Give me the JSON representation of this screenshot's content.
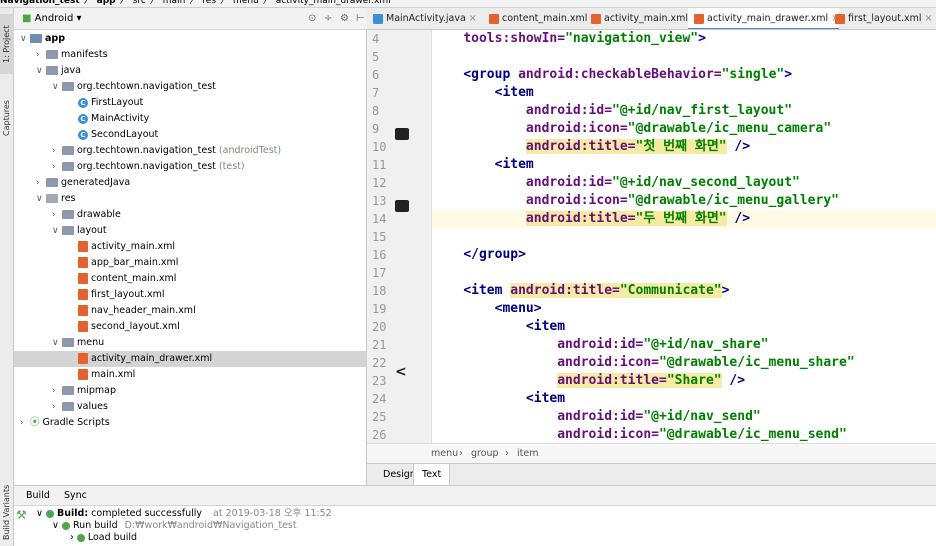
{
  "breadcrumb": [
    "Navigation_test",
    "app",
    "src",
    "main",
    "res",
    "menu",
    "activity_main_drawer.xml"
  ],
  "left_strip": {
    "project": "1: Project",
    "captures": "Captures",
    "build_variants": "Build Variants"
  },
  "project_panel": {
    "view_selector": "Android",
    "tree": [
      {
        "label": "app",
        "depth": 0,
        "kind": "app",
        "arrow": "v"
      },
      {
        "label": "manifests",
        "depth": 1,
        "kind": "folder",
        "arrow": ">"
      },
      {
        "label": "java",
        "depth": 1,
        "kind": "folder",
        "arrow": "v"
      },
      {
        "label": "org.techtown.navigation_test",
        "depth": 2,
        "kind": "folder",
        "arrow": "v"
      },
      {
        "label": "FirstLayout",
        "depth": 3,
        "kind": "class"
      },
      {
        "label": "MainActivity",
        "depth": 3,
        "kind": "class"
      },
      {
        "label": "SecondLayout",
        "depth": 3,
        "kind": "class"
      },
      {
        "label": "org.techtown.navigation_test",
        "suffix": "(androidTest)",
        "depth": 2,
        "kind": "folder",
        "arrow": ">"
      },
      {
        "label": "org.techtown.navigation_test",
        "suffix": "(test)",
        "depth": 2,
        "kind": "folder",
        "arrow": ">"
      },
      {
        "label": "generatedJava",
        "depth": 1,
        "kind": "folder",
        "arrow": ">"
      },
      {
        "label": "res",
        "depth": 1,
        "kind": "res",
        "arrow": "v"
      },
      {
        "label": "drawable",
        "depth": 2,
        "kind": "folder",
        "arrow": ">"
      },
      {
        "label": "layout",
        "depth": 2,
        "kind": "folder",
        "arrow": "v"
      },
      {
        "label": "activity_main.xml",
        "depth": 3,
        "kind": "xml"
      },
      {
        "label": "app_bar_main.xml",
        "depth": 3,
        "kind": "xml"
      },
      {
        "label": "content_main.xml",
        "depth": 3,
        "kind": "xml"
      },
      {
        "label": "first_layout.xml",
        "depth": 3,
        "kind": "xml"
      },
      {
        "label": "nav_header_main.xml",
        "depth": 3,
        "kind": "xml"
      },
      {
        "label": "second_layout.xml",
        "depth": 3,
        "kind": "xml"
      },
      {
        "label": "menu",
        "depth": 2,
        "kind": "folder",
        "arrow": "v"
      },
      {
        "label": "activity_main_drawer.xml",
        "depth": 3,
        "kind": "xml",
        "selected": true
      },
      {
        "label": "main.xml",
        "depth": 3,
        "kind": "xml"
      },
      {
        "label": "mipmap",
        "depth": 2,
        "kind": "folder",
        "arrow": ">"
      },
      {
        "label": "values",
        "depth": 2,
        "kind": "folder",
        "arrow": ">"
      },
      {
        "label": "Gradle Scripts",
        "depth": 0,
        "kind": "gradle",
        "arrow": ">"
      }
    ]
  },
  "editor_tabs": [
    {
      "label": "MainActivity.java",
      "color": "#3a8fd8"
    },
    {
      "label": "content_main.xml",
      "color": "#e3622d"
    },
    {
      "label": "activity_main.xml",
      "color": "#e3622d"
    },
    {
      "label": "activity_main_drawer.xml",
      "color": "#e3622d",
      "active": true
    },
    {
      "label": "first_layout.xml",
      "color": "#e3622d"
    }
  ],
  "code_lines": [
    {
      "n": "4",
      "indent": "    ",
      "parts": [
        [
          "at",
          "tools:showIn="
        ],
        [
          "av",
          "\"navigation_view\""
        ],
        [
          "tg",
          ">"
        ]
      ]
    },
    {
      "n": "5",
      "indent": "",
      "parts": []
    },
    {
      "n": "6",
      "indent": "    ",
      "parts": [
        [
          "tg",
          "<group "
        ],
        [
          "at",
          "android:checkableBehavior="
        ],
        [
          "av",
          "\"single\""
        ],
        [
          "tg",
          ">"
        ]
      ]
    },
    {
      "n": "7",
      "indent": "        ",
      "parts": [
        [
          "tg",
          "<item"
        ]
      ]
    },
    {
      "n": "8",
      "indent": "            ",
      "parts": [
        [
          "at",
          "android:id="
        ],
        [
          "av",
          "\"@+id/nav_first_layout\""
        ]
      ]
    },
    {
      "n": "9",
      "indent": "            ",
      "parts": [
        [
          "at",
          "android:icon="
        ],
        [
          "av",
          "\"@drawable/ic_menu_camera\""
        ]
      ]
    },
    {
      "n": "10",
      "indent": "            ",
      "parts": [
        [
          "hat",
          "android:title="
        ],
        [
          "hav",
          "\"첫 번째 화면\""
        ],
        [
          "tg",
          " />"
        ]
      ]
    },
    {
      "n": "11",
      "indent": "        ",
      "parts": [
        [
          "tg",
          "<item"
        ]
      ]
    },
    {
      "n": "12",
      "indent": "            ",
      "parts": [
        [
          "at",
          "android:id="
        ],
        [
          "av",
          "\"@+id/nav_second_layout\""
        ]
      ]
    },
    {
      "n": "13",
      "indent": "            ",
      "parts": [
        [
          "at",
          "android:icon="
        ],
        [
          "av",
          "\"@drawable/ic_menu_gallery\""
        ]
      ]
    },
    {
      "n": "14",
      "indent": "            ",
      "parts": [
        [
          "hat",
          "android:title="
        ],
        [
          "hav",
          "\"두 번째 화면\""
        ],
        [
          "tg",
          " />"
        ]
      ],
      "current": true
    },
    {
      "n": "15",
      "indent": "",
      "parts": []
    },
    {
      "n": "16",
      "indent": "    ",
      "parts": [
        [
          "tg",
          "</group>"
        ]
      ]
    },
    {
      "n": "17",
      "indent": "",
      "parts": []
    },
    {
      "n": "18",
      "indent": "    ",
      "parts": [
        [
          "tg",
          "<item "
        ],
        [
          "hat",
          "android:title="
        ],
        [
          "hav",
          "\"Communicate\""
        ],
        [
          "tg",
          ">"
        ]
      ]
    },
    {
      "n": "19",
      "indent": "        ",
      "parts": [
        [
          "tg",
          "<menu>"
        ]
      ]
    },
    {
      "n": "20",
      "indent": "            ",
      "parts": [
        [
          "tg",
          "<item"
        ]
      ]
    },
    {
      "n": "21",
      "indent": "                ",
      "parts": [
        [
          "at",
          "android:id="
        ],
        [
          "av",
          "\"@+id/nav_share\""
        ]
      ]
    },
    {
      "n": "22",
      "indent": "                ",
      "parts": [
        [
          "at",
          "android:icon="
        ],
        [
          "av",
          "\"@drawable/ic_menu_share\""
        ]
      ]
    },
    {
      "n": "23",
      "indent": "                ",
      "parts": [
        [
          "hat",
          "android:title="
        ],
        [
          "hav",
          "\"Share\""
        ],
        [
          "tg",
          " />"
        ]
      ]
    },
    {
      "n": "24",
      "indent": "            ",
      "parts": [
        [
          "tg",
          "<item"
        ]
      ]
    },
    {
      "n": "25",
      "indent": "                ",
      "parts": [
        [
          "at",
          "android:id="
        ],
        [
          "av",
          "\"@+id/nav_send\""
        ]
      ]
    },
    {
      "n": "26",
      "indent": "                ",
      "parts": [
        [
          "at",
          "android:icon="
        ],
        [
          "av",
          "\"@drawable/ic_menu_send\""
        ]
      ]
    }
  ],
  "code_crumb": [
    "menu",
    "group",
    "item"
  ],
  "design_tabs": [
    "Design",
    "Text"
  ],
  "build": {
    "tabs": [
      "Build",
      "Sync"
    ],
    "status_label": "Build:",
    "status_text": "completed successfully",
    "status_time": "at 2019-03-18 오후 11:52",
    "run_build": "Run build",
    "run_path": "D:₩work₩android₩Navigation_test",
    "load_build": "Load build"
  },
  "colors": {
    "accent": "#4a86c8",
    "success": "#4aa74a",
    "xml": "#e3622d"
  }
}
